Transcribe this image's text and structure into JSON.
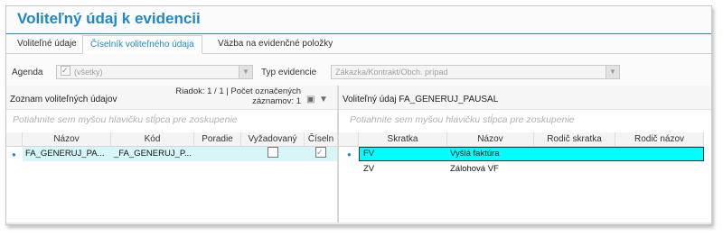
{
  "window": {
    "title": "Voliteľný údaj k evidencii"
  },
  "tabs": [
    {
      "label": "Voliteľné údaje",
      "active": false
    },
    {
      "label": "Číselník voliteľného údaja",
      "active": true
    },
    {
      "label": "Väzba na evidenčné položky",
      "active": false
    }
  ],
  "toolbar": {
    "agenda_label": "Agenda",
    "agenda_value": "(všetky)",
    "agenda_checked": true,
    "typ_label": "Typ evidencie",
    "typ_value": "Zákazka/Kontrakt/Obch. prípad"
  },
  "left_panel": {
    "title": "Zoznam voliteľných údajov",
    "info_line1": "Riadok: 1 / 1 | Počet označených",
    "info_line2": "záznamov: 1",
    "group_hint": "Potiahnite sem myšou hlavičku stĺpca pre zoskupenie",
    "columns": [
      "Názov",
      "Kód",
      "Poradie",
      "Vyžadovaný",
      "Číseln"
    ],
    "rows": [
      {
        "nazov": "FA_GENERUJ_PA...",
        "kod": "_FA_GENERUJ_P...",
        "poradie": "",
        "vyzadovany": false,
        "ciselnik": true
      }
    ]
  },
  "right_panel": {
    "title": "Voliteľný údaj FA_GENERUJ_PAUSAL",
    "group_hint": "Potiahnite sem myšou hlavičku stĺpca pre zoskupenie",
    "columns": [
      "Skratka",
      "Názov",
      "Rodič skratka",
      "Rodič názov"
    ],
    "rows": [
      {
        "skratka": "FV",
        "nazov": "Vyšlá faktúra",
        "rodic_skratka": "",
        "rodic_nazov": ""
      },
      {
        "skratka": "ZV",
        "nazov": "Zálohová VF",
        "rodic_skratka": "",
        "rodic_nazov": ""
      }
    ]
  },
  "colors": {
    "accent": "#1e88c8",
    "selected_row": "#00ffff",
    "left_selected_row": "#d7f6f7"
  }
}
